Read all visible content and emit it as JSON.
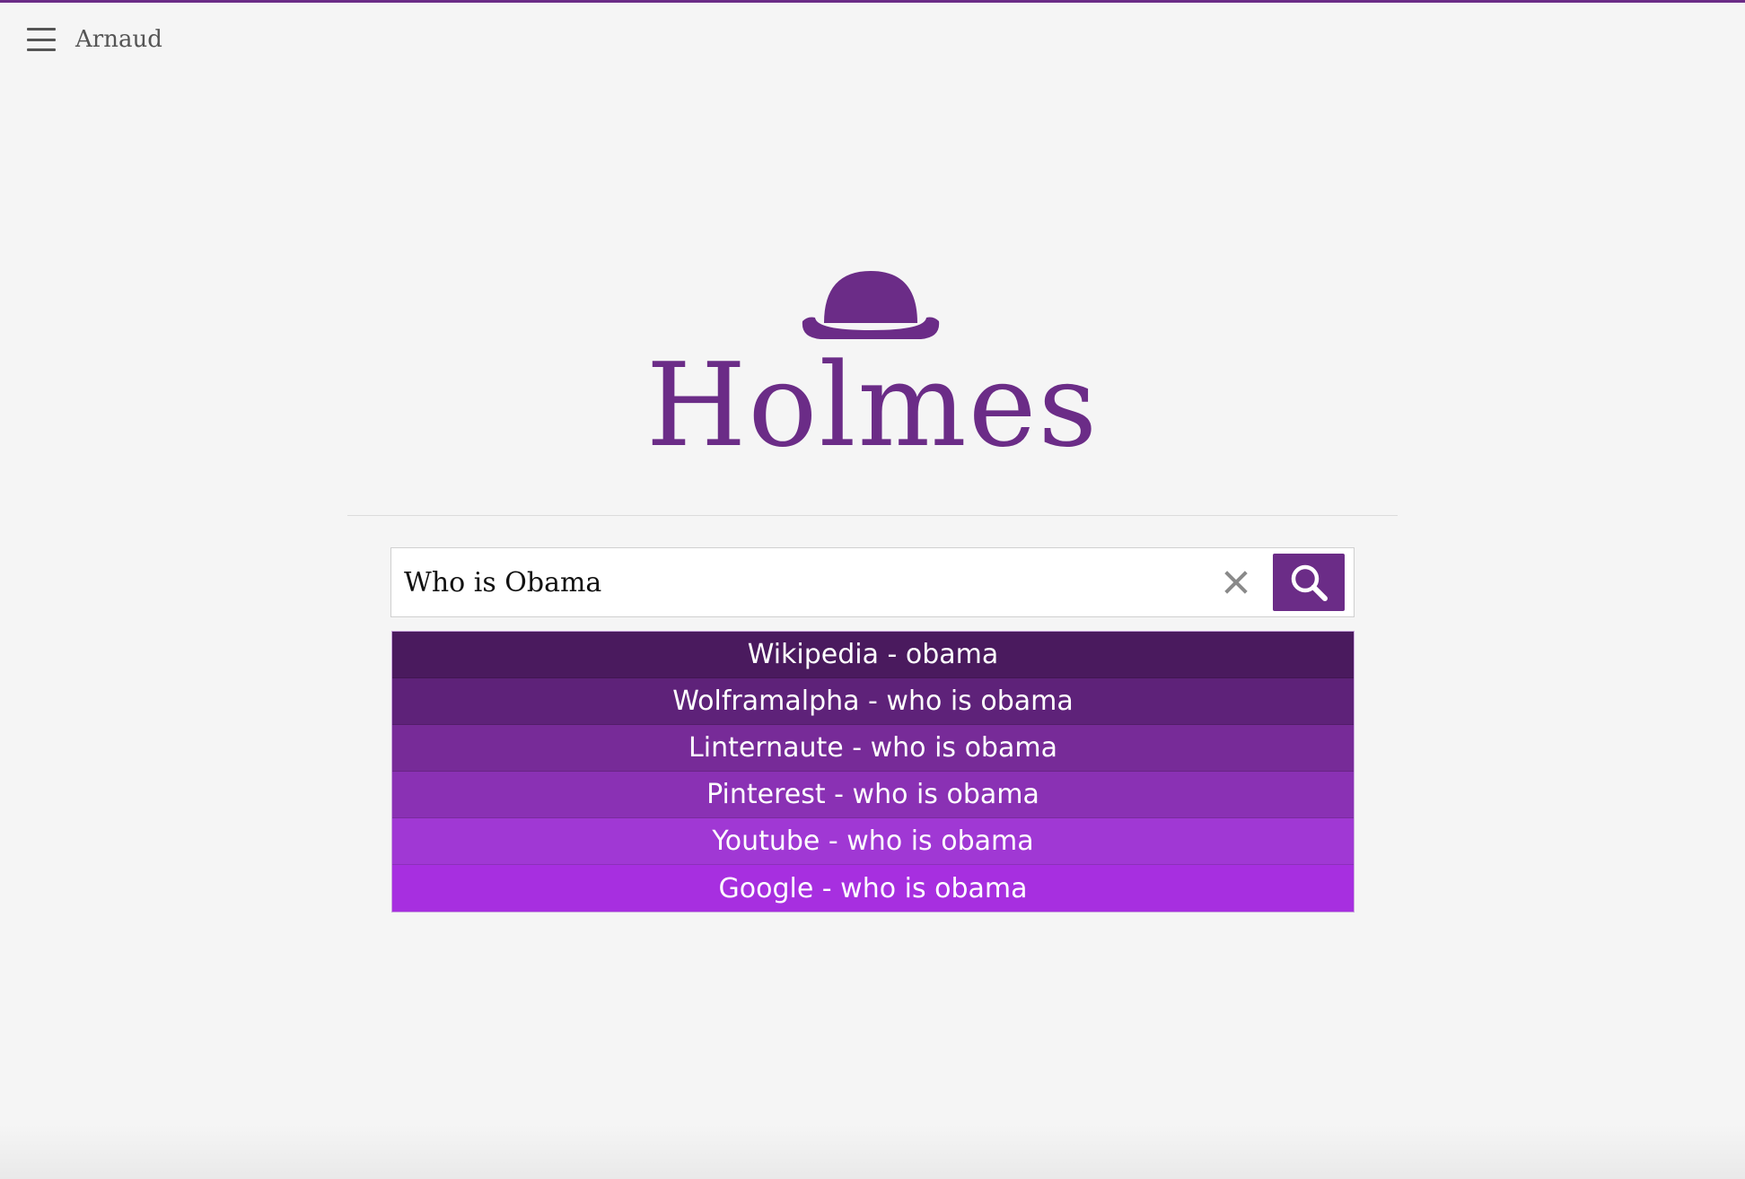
{
  "header": {
    "user_name": "Arnaud"
  },
  "logo": {
    "title": "Holmes",
    "icon": "bowler-hat-icon",
    "color": "#6b2c87"
  },
  "search": {
    "value": "Who is Obama",
    "placeholder": ""
  },
  "suggestions": [
    {
      "label": "Wikipedia - obama",
      "color": "#4a1a5e"
    },
    {
      "label": "Wolframalpha - who is obama",
      "color": "#5e2279"
    },
    {
      "label": "Linternaute - who is obama",
      "color": "#772b98"
    },
    {
      "label": "Pinterest - who is obama",
      "color": "#8a31b4"
    },
    {
      "label": "Youtube - who is obama",
      "color": "#a038d4"
    },
    {
      "label": "Google - who is obama",
      "color": "#a72fe0"
    }
  ],
  "colors": {
    "accent": "#6b2c87",
    "background": "#f5f5f5"
  }
}
